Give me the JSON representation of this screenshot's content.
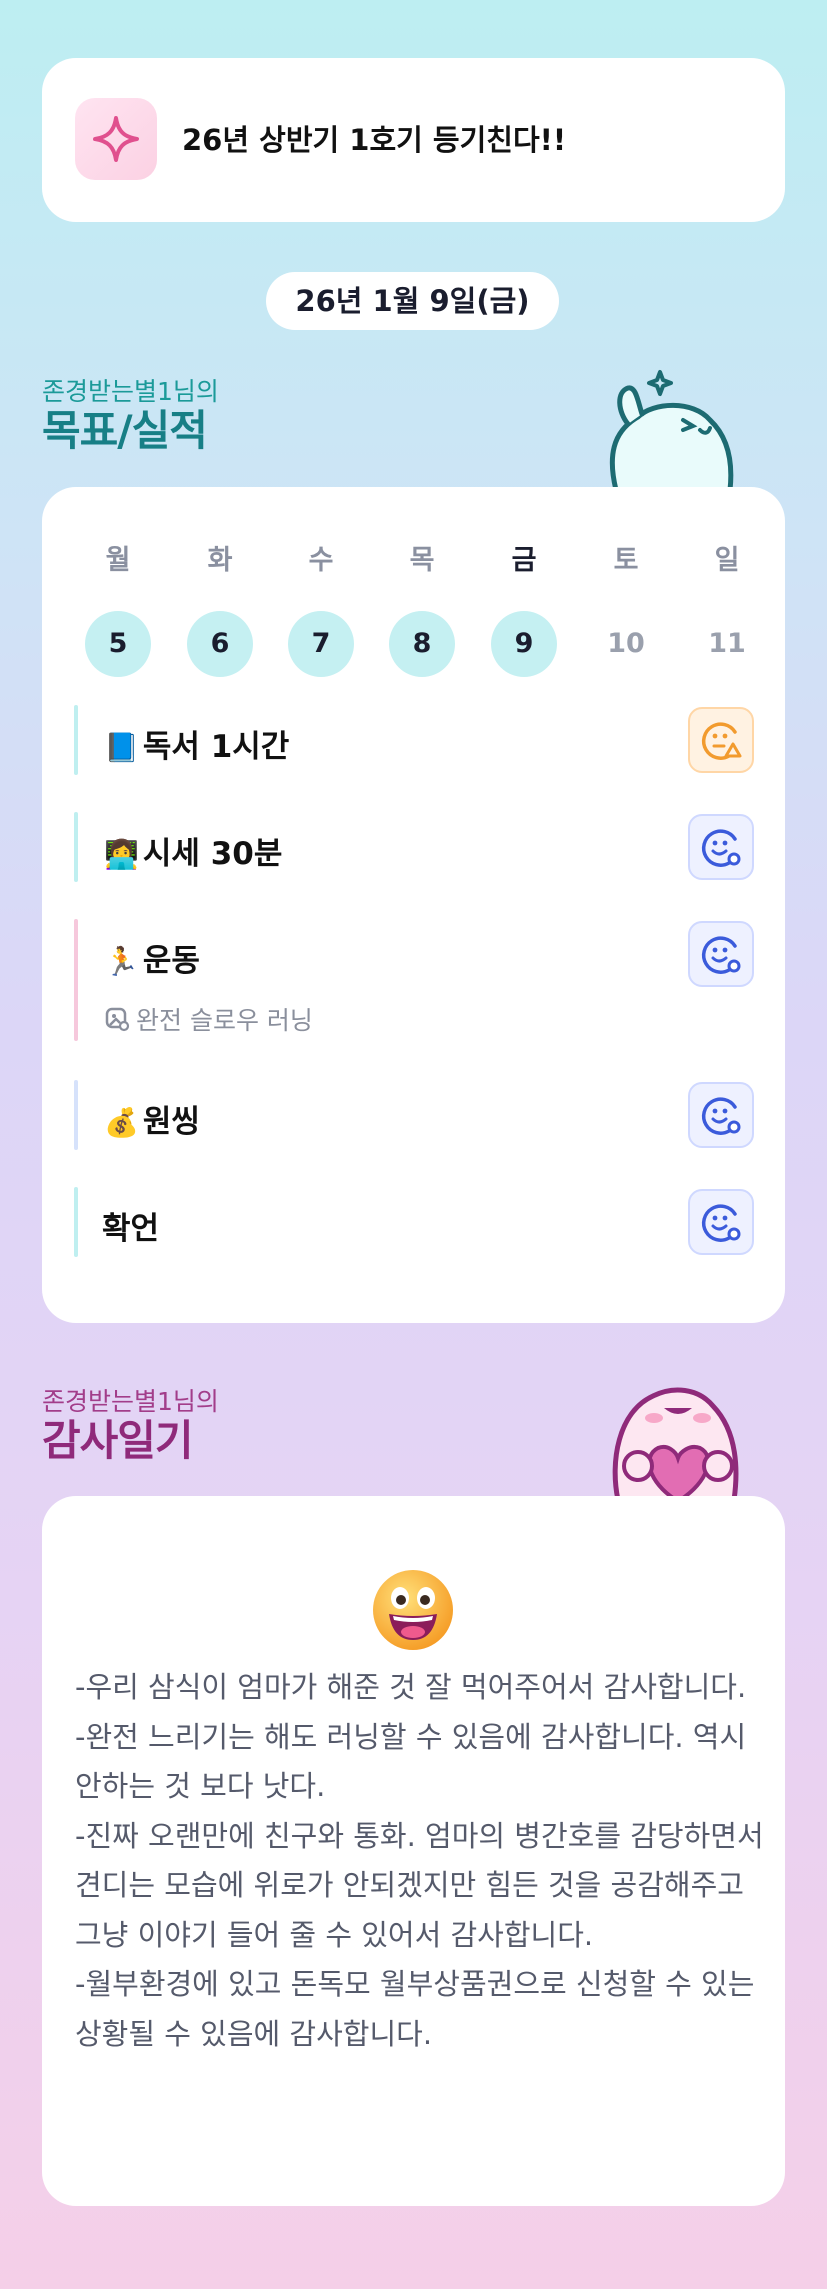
{
  "header": {
    "title": "26년 상반기 1호기 등기친다!!",
    "icon": "sparkle-icon"
  },
  "date": "26년 1월 9일(금)",
  "goals_section": {
    "subtitle": "존경받는별1님의",
    "title": "목표/실적"
  },
  "week": [
    {
      "name": "월",
      "num": "5",
      "state": "done"
    },
    {
      "name": "화",
      "num": "6",
      "state": "done"
    },
    {
      "name": "수",
      "num": "7",
      "state": "done"
    },
    {
      "name": "목",
      "num": "8",
      "state": "done"
    },
    {
      "name": "금",
      "num": "9",
      "state": "today"
    },
    {
      "name": "토",
      "num": "10",
      "state": "future"
    },
    {
      "name": "일",
      "num": "11",
      "state": "future"
    }
  ],
  "goals": [
    {
      "emoji": "📘",
      "label": "독서 1시간",
      "status": "warning-face-icon",
      "bar_color": "#bfeff0"
    },
    {
      "emoji": "👩‍💻",
      "label": "시세 30분",
      "status": "smile-check-icon",
      "bar_color": "#bfeff0"
    },
    {
      "emoji": "🏃",
      "label": "운동",
      "note": "완전 슬로우 러닝",
      "status": "smile-check-icon",
      "bar_color": "#f6c8dc"
    },
    {
      "emoji": "💰",
      "label": "원씽",
      "status": "smile-check-icon",
      "bar_color": "#d6e2fb"
    },
    {
      "emoji": "",
      "label": "확언",
      "status": "smile-check-icon",
      "bar_color": "#bfeff0"
    }
  ],
  "thanks_section": {
    "subtitle": "존경받는별1님의",
    "title": "감사일기"
  },
  "thanks_text": "-우리 삼식이 엄마가 해준 것 잘 먹어주어서 감사합니다.\n-완전 느리기는 해도 러닝할 수 있음에 감사합니다. 역시 안하는 것 보다 낫다.\n-진짜 오랜만에 친구와 통화. 엄마의 병간호를 감당하면서 견디는 모습에 위로가 안되겠지만 힘든 것을 공감해주고 그냥 이야기 들어 줄 수 있어서 감사합니다.\n-월부환경에 있고 돈독모 월부상품권으로 신청할 수 있는 상황될 수 있음에 감사합니다.",
  "colors": {
    "teal_title": "#177f86",
    "plum_title": "#8f2a7a",
    "day_done": "#c5f0f2"
  }
}
